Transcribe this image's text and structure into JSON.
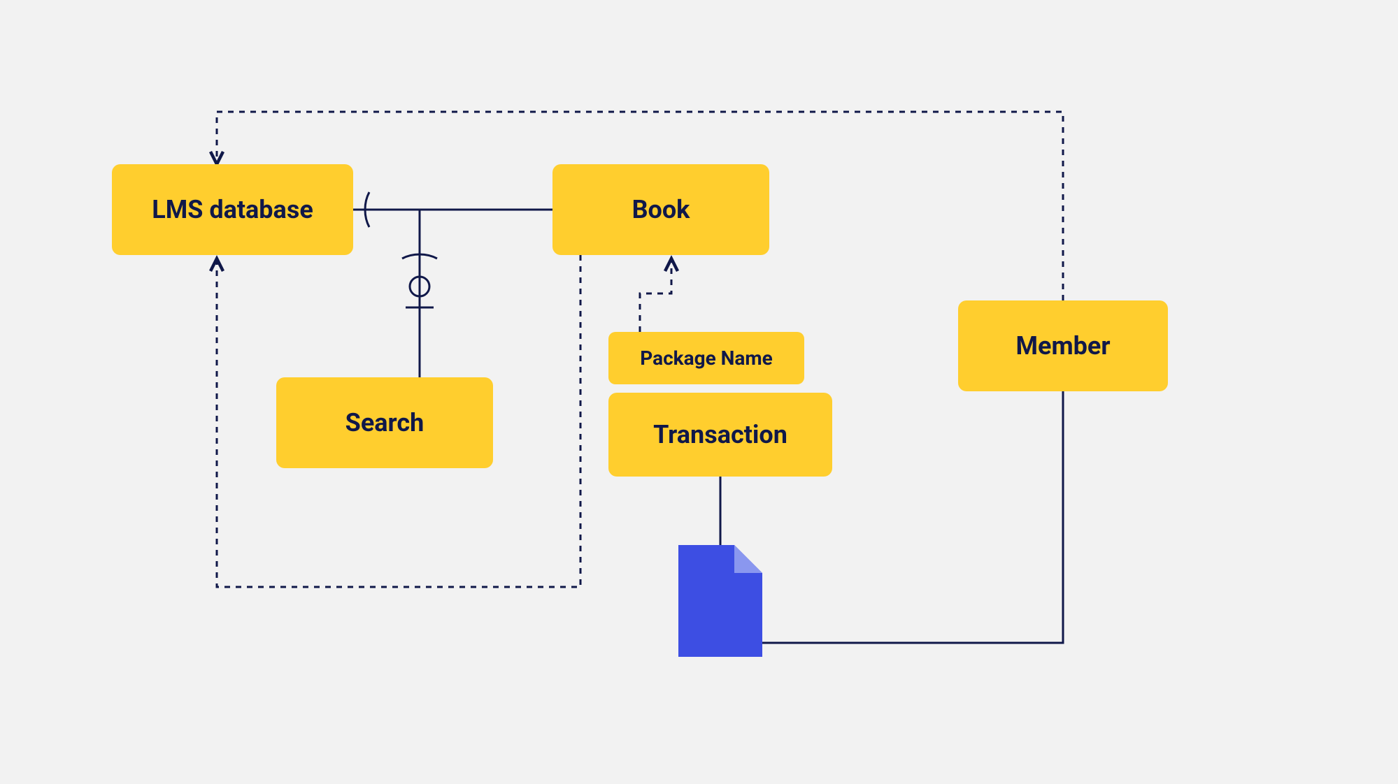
{
  "nodes": {
    "lms_database": {
      "label": "LMS database"
    },
    "book": {
      "label": "Book"
    },
    "search": {
      "label": "Search"
    },
    "package_name": {
      "label": "Package Name"
    },
    "transaction": {
      "label": "Transaction"
    },
    "member": {
      "label": "Member"
    }
  },
  "colors": {
    "node_fill": "#ffce2e",
    "line": "#101849",
    "doc_fill": "#3d4ee3",
    "background": "#f2f2f2"
  },
  "edges": {
    "description": "LMS database connects to Book (solid, with crow's-foot / mandatory notation). LMS database connects to Search (solid, with optional/zero-or-one notation). Book dashed down to main dependency bus and back up to LMS database (dashed arrow). Package Name dashed up to Book (dashed arrow). Transaction solid down to document icon. Document icon solid across and up to Member. Member dashed across top to LMS database (dashed arrow)."
  }
}
